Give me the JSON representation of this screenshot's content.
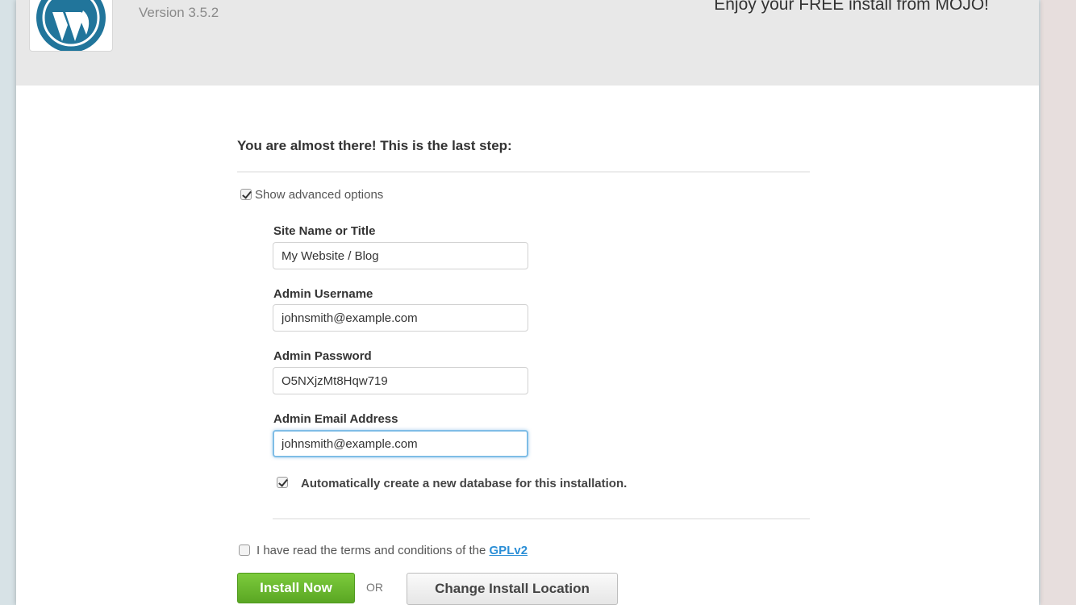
{
  "header": {
    "version": "Version 3.5.2",
    "promo": "Enjoy your FREE install from MOJO!",
    "logo_icon": "wordpress-logo-icon"
  },
  "main": {
    "step_title": "You are almost there! This is the last step:",
    "advanced_options": {
      "label": "Show advanced options",
      "checked": true
    },
    "fields": {
      "site_name": {
        "label": "Site Name or Title",
        "value": "My Website / Blog"
      },
      "admin_username": {
        "label": "Admin Username",
        "value": "johnsmith@example.com"
      },
      "admin_password": {
        "label": "Admin Password",
        "value": "O5NXjzMt8Hqw719"
      },
      "admin_email": {
        "label": "Admin Email Address",
        "value": "johnsmith@example.com"
      }
    },
    "auto_db": {
      "label": "Automatically create a new database for this installation.",
      "checked": true
    },
    "terms": {
      "label": "I have read the terms and conditions of the",
      "link": "GPLv2",
      "checked": false
    },
    "install_button": "Install Now",
    "or_text": "OR",
    "change_location_button": "Change Install Location"
  },
  "colors": {
    "accent_green": "#6bbb2f",
    "link_blue": "#2a8ed6",
    "wordpress_blue": "#21759b",
    "focus_blue": "#7fbde6"
  }
}
